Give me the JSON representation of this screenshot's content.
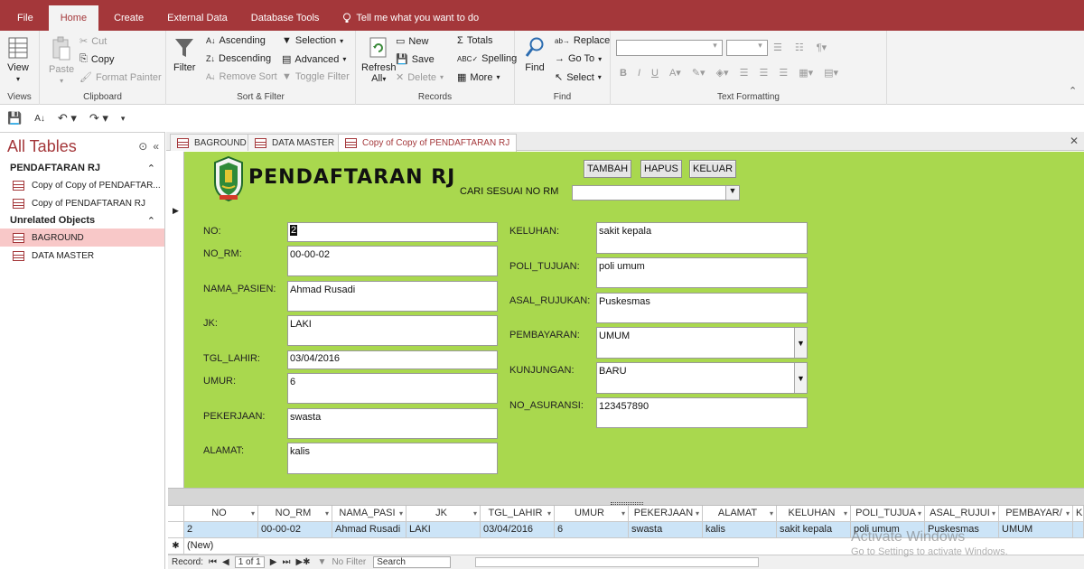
{
  "menu": {
    "tabs": [
      "File",
      "Home",
      "Create",
      "External Data",
      "Database Tools"
    ],
    "tell_me": "Tell me what you want to do"
  },
  "ribbon": {
    "views": {
      "view": "View",
      "label": "Views"
    },
    "clipboard": {
      "paste": "Paste",
      "cut": "Cut",
      "copy": "Copy",
      "format_painter": "Format Painter",
      "label": "Clipboard"
    },
    "sort_filter": {
      "filter": "Filter",
      "ascending": "Ascending",
      "descending": "Descending",
      "remove_sort": "Remove Sort",
      "selection": "Selection",
      "advanced": "Advanced",
      "toggle_filter": "Toggle Filter",
      "label": "Sort & Filter"
    },
    "records": {
      "refresh": "Refresh",
      "refresh_all": "All",
      "new": "New",
      "save": "Save",
      "delete": "Delete",
      "totals": "Totals",
      "spelling": "Spelling",
      "more": "More",
      "label": "Records"
    },
    "find": {
      "find": "Find",
      "replace": "Replace",
      "goto": "Go To",
      "select": "Select",
      "label": "Find"
    },
    "text_formatting": {
      "label": "Text Formatting"
    }
  },
  "nav": {
    "title": "All Tables",
    "groups": [
      {
        "name": "PENDAFTARAN RJ",
        "items": [
          "Copy of Copy of PENDAFTAR...",
          "Copy of PENDAFTARAN RJ"
        ]
      },
      {
        "name": "Unrelated Objects",
        "items": [
          "BAGROUND",
          "DATA MASTER"
        ]
      }
    ]
  },
  "doc_tabs": [
    "BAGROUND",
    "DATA MASTER",
    "Copy of Copy of PENDAFTARAN RJ"
  ],
  "form": {
    "title": "PENDAFTARAN RJ",
    "buttons": {
      "add": "TAMBAH",
      "delete": "HAPUS",
      "exit": "KELUAR"
    },
    "search_label": "CARI SESUAI NO RM",
    "left_fields": [
      {
        "label": "NO:",
        "value": "2"
      },
      {
        "label": "NO_RM:",
        "value": "00-00-02"
      },
      {
        "label": "NAMA_PASIEN:",
        "value": "Ahmad Rusadi"
      },
      {
        "label": "JK:",
        "value": "LAKI"
      },
      {
        "label": "TGL_LAHIR:",
        "value": "03/04/2016"
      },
      {
        "label": "UMUR:",
        "value": "6"
      },
      {
        "label": "PEKERJAAN:",
        "value": "swasta"
      },
      {
        "label": "ALAMAT:",
        "value": "kalis"
      }
    ],
    "right_fields": [
      {
        "label": "KELUHAN:",
        "value": "sakit kepala"
      },
      {
        "label": "POLI_TUJUAN:",
        "value": "poli umum"
      },
      {
        "label": "ASAL_RUJUKAN:",
        "value": "Puskesmas"
      },
      {
        "label": "PEMBAYARAN:",
        "value": "UMUM"
      },
      {
        "label": "KUNJUNGAN:",
        "value": "BARU"
      },
      {
        "label": "NO_ASURANSI:",
        "value": "123457890"
      }
    ]
  },
  "datasheet": {
    "columns": [
      "NO",
      "NO_RM",
      "NAMA_PASI",
      "JK",
      "TGL_LAHIR",
      "UMUR",
      "PEKERJAAN",
      "ALAMAT",
      "KELUHAN",
      "POLI_TUJUA",
      "ASAL_RUJUI",
      "PEMBAYAR/",
      "K"
    ],
    "row": [
      "2",
      "00-00-02",
      "Ahmad Rusadi",
      "LAKI",
      "03/04/2016",
      "6",
      "swasta",
      "kalis",
      "sakit kepala",
      "poli umum",
      "Puskesmas",
      "UMUM",
      ""
    ],
    "new_row": "(New)"
  },
  "record_nav": {
    "label": "Record:",
    "position": "1 of 1",
    "filter": "No Filter",
    "search": "Search"
  },
  "watermark": {
    "line1": "Activate Windows",
    "line2": "Go to Settings to activate Windows."
  }
}
